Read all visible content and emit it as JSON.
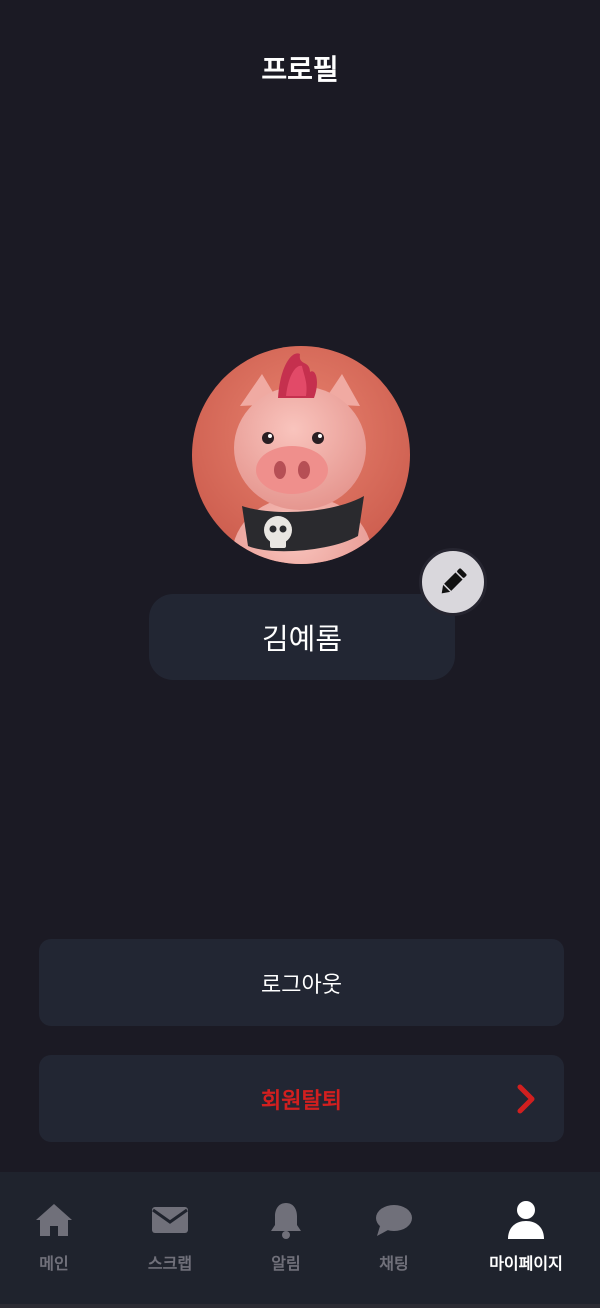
{
  "header": {
    "title": "프로필"
  },
  "profile": {
    "name": "김예롬",
    "avatar_icon": "pig-avatar-image",
    "edit_icon": "pencil-icon"
  },
  "actions": {
    "logout_label": "로그아웃",
    "withdraw_label": "회원탈퇴",
    "withdraw_color": "#d21f1f"
  },
  "tabbar": {
    "active_color": "#ffffff",
    "inactive_color": "#70707a",
    "items": [
      {
        "label": "메인",
        "icon": "home-icon",
        "active": false
      },
      {
        "label": "스크랩",
        "icon": "envelope-icon",
        "active": false
      },
      {
        "label": "알림",
        "icon": "bell-icon",
        "active": false
      },
      {
        "label": "채팅",
        "icon": "chat-bubble-icon",
        "active": false
      },
      {
        "label": "마이페이지",
        "icon": "user-icon",
        "active": true
      }
    ]
  }
}
